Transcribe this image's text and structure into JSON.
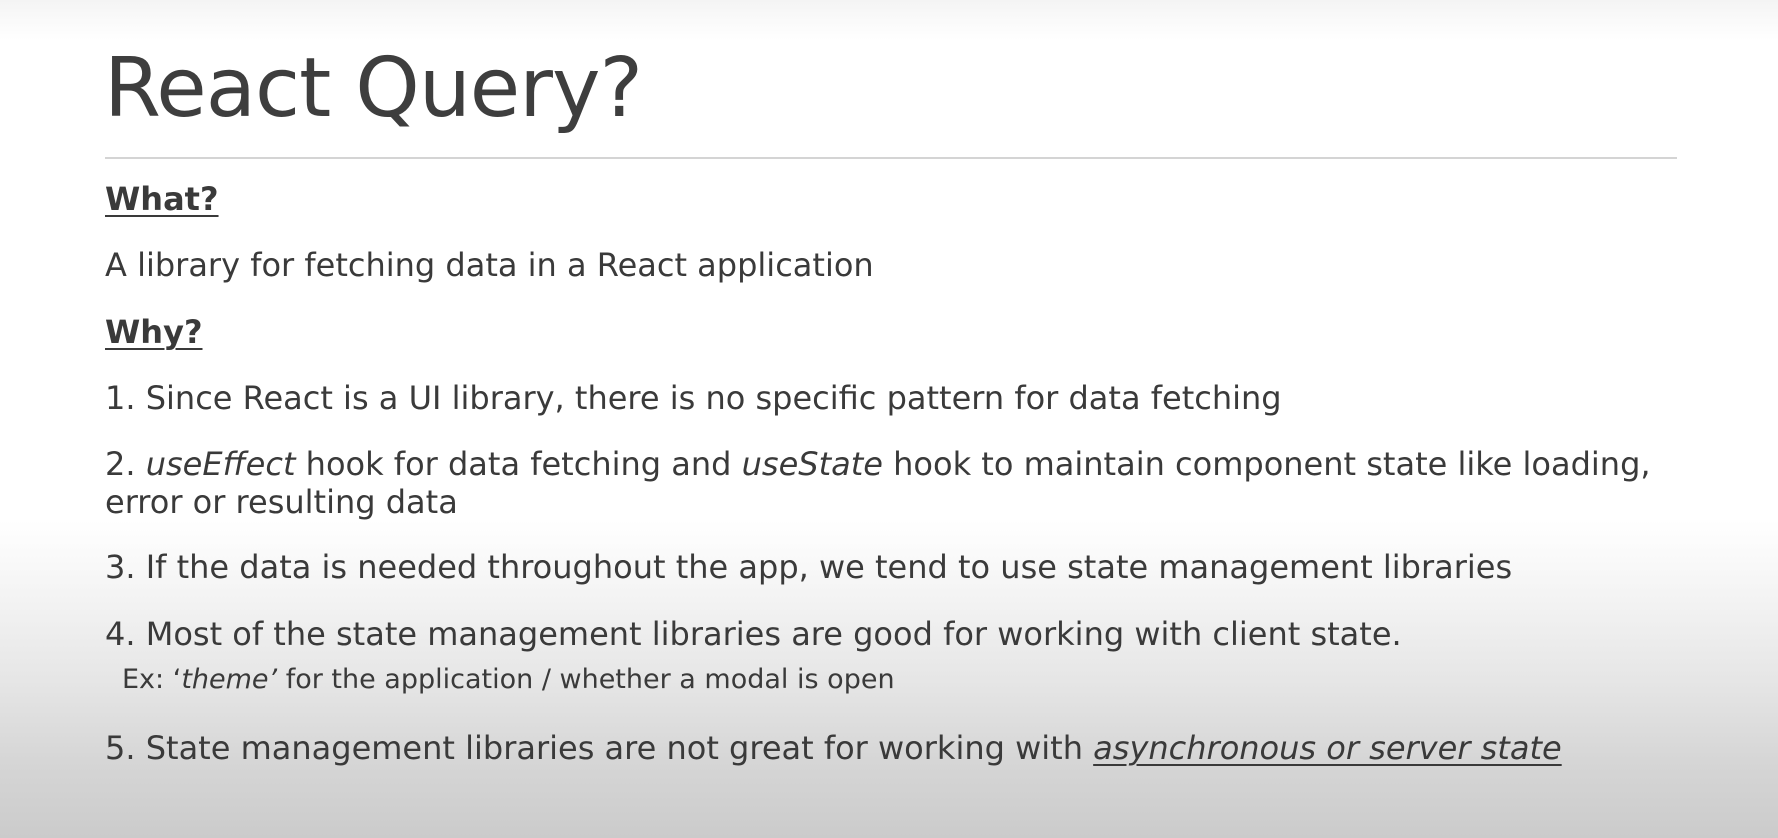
{
  "slide": {
    "title": "React Query?",
    "what_heading": "What?",
    "what_text": "A library for fetching data in a React application",
    "why_heading": "Why?",
    "points": {
      "p1": "1. Since React is a UI library, there is no specific pattern for data fetching",
      "p2_num": "2. ",
      "p2_hook1": "useEffect",
      "p2_mid": " hook for data fetching and ",
      "p2_hook2": "useState",
      "p2_end": " hook to maintain component state like loading,",
      "p2_line2": "error or resulting data",
      "p3": "3. If the data is needed throughout the app, we tend to use state management libraries",
      "p4": "4. Most of the state management libraries are good for working with client state.",
      "p4_ex_pre": "Ex: ‘",
      "p4_ex_theme": "theme’",
      "p4_ex_post": " for the application / whether a modal is open",
      "p5_pre": "5. State management libraries are not great for working with ",
      "p5_emph": "asynchronous or server state"
    }
  }
}
